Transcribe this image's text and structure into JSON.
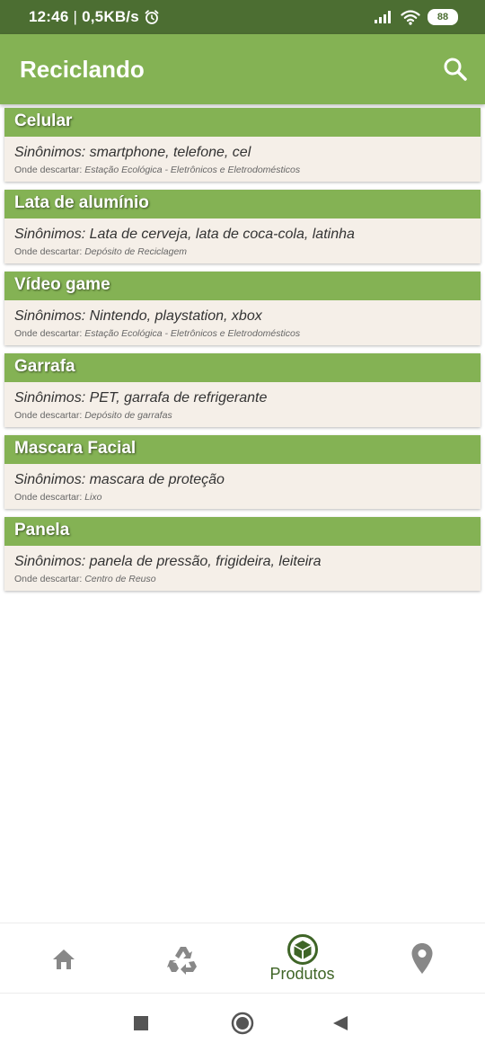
{
  "status_bar": {
    "time": "12:46",
    "speed": "0,5KB/s",
    "battery": "88"
  },
  "app_bar": {
    "title": "Reciclando",
    "search_icon": "search-icon"
  },
  "colors": {
    "status_bar": "#4c6e32",
    "accent_green": "#84b254",
    "card_body": "#f5efe8",
    "nav_active": "#3f6527",
    "nav_inactive": "#888888"
  },
  "products": [
    {
      "name": "Celular",
      "synonyms": "Sinônimos: smartphone, telefone, cel",
      "where_label": "Onde descartar:",
      "where": "Estação Ecológica - Eletrônicos e Eletrodomésticos"
    },
    {
      "name": "Lata de alumínio",
      "synonyms": "Sinônimos: Lata de cerveja, lata de coca-cola, latinha",
      "where_label": "Onde descartar:",
      "where": "Depósito de Reciclagem"
    },
    {
      "name": "Vídeo game",
      "synonyms": "Sinônimos: Nintendo, playstation, xbox",
      "where_label": "Onde descartar:",
      "where": "Estação Ecológica - Eletrônicos e Eletrodomésticos"
    },
    {
      "name": "Garrafa",
      "synonyms": "Sinônimos: PET, garrafa de refrigerante",
      "where_label": "Onde descartar:",
      "where": "Depósito de garrafas"
    },
    {
      "name": "Mascara Facial",
      "synonyms": "Sinônimos: mascara de proteção",
      "where_label": "Onde descartar:",
      "where": "Lixo"
    },
    {
      "name": "Panela",
      "synonyms": "Sinônimos: panela de pressão, frigideira, leiteira",
      "where_label": "Onde descartar:",
      "where": "Centro de Reuso"
    }
  ],
  "bottom_nav": {
    "items": [
      {
        "icon": "home-icon",
        "label": ""
      },
      {
        "icon": "recycle-icon",
        "label": ""
      },
      {
        "icon": "box-icon",
        "label": "Produtos",
        "active": true
      },
      {
        "icon": "location-pin-icon",
        "label": ""
      }
    ]
  },
  "system_nav": {
    "icons": [
      "recents-square-icon",
      "home-circle-icon",
      "back-triangle-icon"
    ]
  }
}
